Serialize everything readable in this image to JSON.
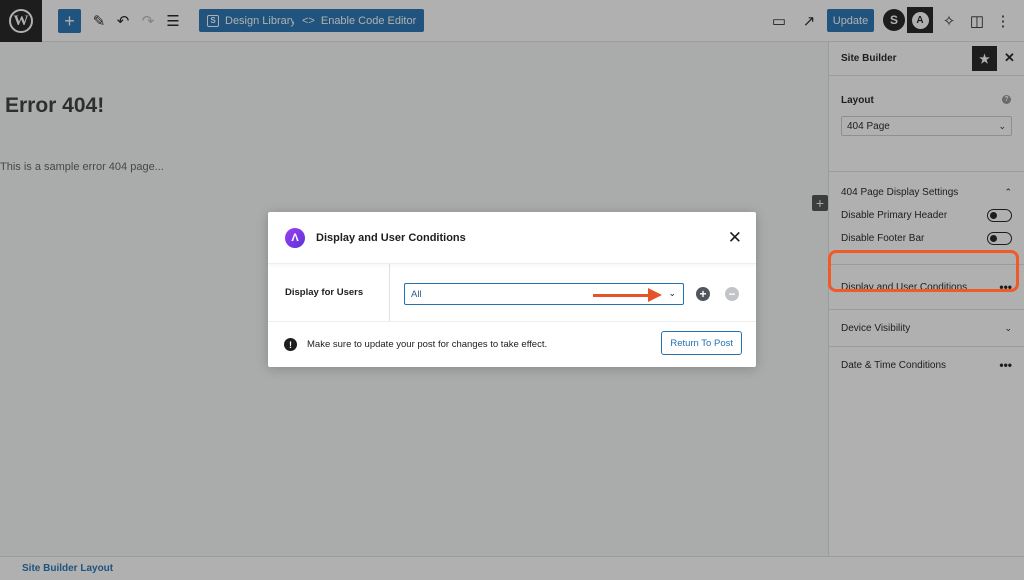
{
  "toolbar": {
    "logo": "W",
    "add_icon": "+",
    "design_library_label": "Design Library",
    "design_library_icon": "S",
    "code_editor_label": "Enable Code Editor",
    "code_editor_icon": "<>",
    "update_label": "Update",
    "spectra_icon": "S",
    "astra_icon": "A",
    "accent_color": "#2271b1"
  },
  "canvas": {
    "heading": "Error 404!",
    "paragraph": "This is a sample error 404 page..."
  },
  "sidebar": {
    "title": "Site Builder",
    "layout": {
      "label": "Layout",
      "selected": "404 Page"
    },
    "display_settings": {
      "title": "404 Page Display Settings",
      "toggles": [
        {
          "label": "Disable Primary Header",
          "on": false
        },
        {
          "label": "Disable Footer Bar",
          "on": false
        }
      ]
    },
    "panels": [
      {
        "label": "Display and User Conditions",
        "icon": "more-dots"
      },
      {
        "label": "Device Visibility",
        "icon": "chevron-down"
      },
      {
        "label": "Date & Time Conditions",
        "icon": "more-dots"
      }
    ]
  },
  "modal": {
    "title": "Display and User Conditions",
    "field_label": "Display for Users",
    "field_value": "All",
    "note": "Make sure to update your post for changes to take effect.",
    "return_label": "Return To Post",
    "highlight_color": "#f05a28"
  },
  "footer": {
    "breadcrumb": "Site Builder Layout"
  }
}
